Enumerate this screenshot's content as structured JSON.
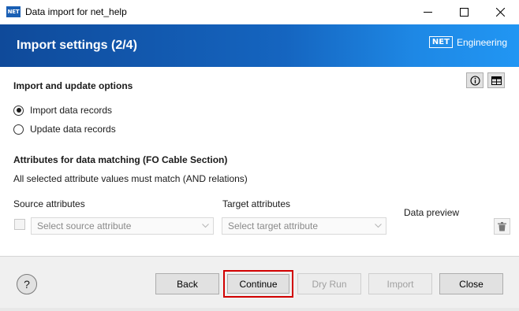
{
  "window": {
    "logo": "NET",
    "title": "Data import for net_help",
    "minimize_glyph": "—",
    "maximize_glyph": "☐",
    "close_glyph": "✕"
  },
  "header": {
    "title": "Import settings (2/4)",
    "brand_box": "NET",
    "brand_text": "Engineering"
  },
  "options": {
    "title": "Import and update options",
    "radios": [
      {
        "label": "Import data records",
        "checked": true
      },
      {
        "label": "Update data records",
        "checked": false
      }
    ],
    "info_icon": "info-icon",
    "table_icon": "table-icon"
  },
  "matching": {
    "title": "Attributes for data matching (FO Cable Section)",
    "description": "All selected attribute values must match (AND relations)",
    "source_label": "Source attributes",
    "target_label": "Target attributes",
    "preview_label": "Data preview",
    "source_placeholder": "Select source attribute",
    "target_placeholder": "Select target attribute"
  },
  "footer": {
    "help": "?",
    "back": "Back",
    "continue": "Continue",
    "dry_run": "Dry Run",
    "import": "Import",
    "close": "Close"
  },
  "colors": {
    "header_start": "#0f4a9a",
    "header_end": "#2196f3",
    "highlight": "#d10000"
  }
}
